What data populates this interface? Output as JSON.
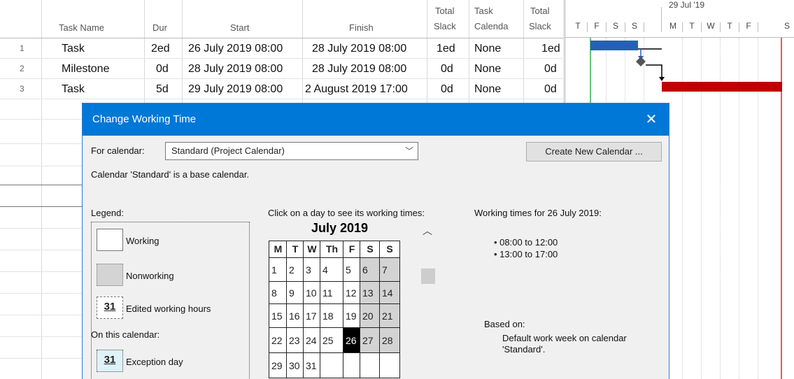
{
  "grid": {
    "headers": {
      "task_name": "Task Name",
      "dur": "Dur",
      "start": "Start",
      "finish": "Finish",
      "total_slack_1": "Total",
      "total_slack_2": "Slack",
      "task_cal_1": "Task",
      "task_cal_2": "Calenda",
      "total_slack2_1": "Total",
      "total_slack2_2": "Slack"
    },
    "rows": [
      {
        "id": "1",
        "name": "Task",
        "dur": "2ed",
        "start": "26 July 2019 08:00",
        "finish": "28 July 2019 08:00",
        "slack": "1ed",
        "calendar": "None",
        "slack2": "1ed"
      },
      {
        "id": "2",
        "name": "Milestone",
        "dur": "0d",
        "start": "28 July 2019 08:00",
        "finish": "28 July 2019 08:00",
        "slack": "0d",
        "calendar": "None",
        "slack2": "0d"
      },
      {
        "id": "3",
        "name": "Task",
        "dur": "5d",
        "start": "29 July 2019 08:00",
        "finish": "2 August 2019 17:00",
        "slack": "0d",
        "calendar": "None",
        "slack2": "0d"
      }
    ]
  },
  "gantt": {
    "week_label": "29 Jul '19",
    "days": [
      "T",
      "F",
      "S",
      "S",
      "M",
      "T",
      "W",
      "T",
      "F",
      "S"
    ],
    "colors": {
      "task_blue": "#2660b4",
      "critical_red": "#c00000",
      "today_green": "#2bb14c",
      "deadline_red": "#e0211f"
    }
  },
  "dialog": {
    "title": "Change Working Time",
    "close_glyph": "✕",
    "for_calendar_label": "For calendar:",
    "calendar_value": "Standard (Project Calendar)",
    "create_button": "Create New Calendar ...",
    "base_note": "Calendar 'Standard' is a base calendar.",
    "legend_title": "Legend:",
    "legend": {
      "working": "Working",
      "nonworking": "Nonworking",
      "edited_num": "31",
      "edited": "Edited working hours",
      "on_this_calendar": "On this calendar:",
      "exception_num": "31",
      "exception": "Exception day"
    },
    "click_hint": "Click on a day to see its working times:",
    "calendar": {
      "month": "July 2019",
      "weekdays": [
        "M",
        "T",
        "W",
        "Th",
        "F",
        "S",
        "S"
      ],
      "weeks": [
        [
          "1",
          "2",
          "3",
          "4",
          "5",
          "6",
          "7"
        ],
        [
          "8",
          "9",
          "10",
          "11",
          "12",
          "13",
          "14"
        ],
        [
          "15",
          "16",
          "17",
          "18",
          "19",
          "20",
          "21"
        ],
        [
          "22",
          "23",
          "24",
          "25",
          "26",
          "27",
          "28"
        ],
        [
          "29",
          "30",
          "31",
          "",
          "",
          "",
          ""
        ]
      ],
      "selected": "26"
    },
    "working_times_title": "Working times for 26 July 2019:",
    "working_times": [
      "• 08:00 to 12:00",
      "• 13:00 to 17:00"
    ],
    "based_on_label": "Based on:",
    "based_on_text_1": "Default work week on calendar",
    "based_on_text_2": "'Standard'."
  }
}
